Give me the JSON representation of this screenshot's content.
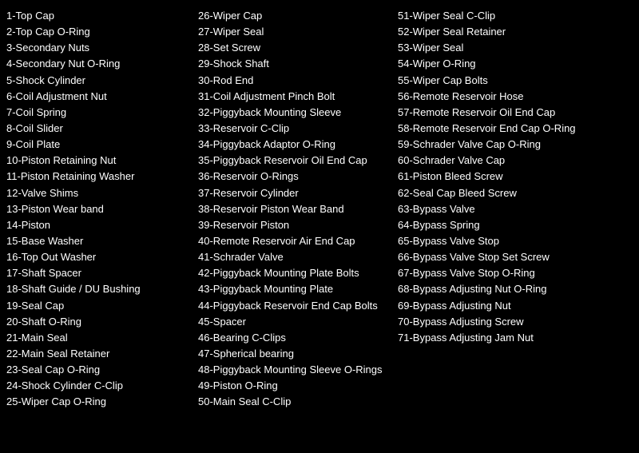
{
  "col1": {
    "items": [
      "1-Top Cap",
      "2-Top Cap O-Ring",
      "3-Secondary Nuts",
      "4-Secondary Nut O-Ring",
      "5-Shock Cylinder",
      "6-Coil Adjustment Nut",
      "7-Coil Spring",
      "8-Coil Slider",
      "9-Coil Plate",
      "10-Piston Retaining Nut",
      "11-Piston Retaining Washer",
      "12-Valve Shims",
      "13-Piston Wear band",
      "14-Piston",
      "15-Base Washer",
      "16-Top Out Washer",
      "17-Shaft Spacer",
      "18-Shaft Guide / DU Bushing",
      "19-Seal Cap",
      "20-Shaft O-Ring",
      "21-Main Seal",
      "22-Main Seal Retainer",
      "23-Seal Cap O-Ring",
      "24-Shock Cylinder C-Clip",
      "25-Wiper Cap O-Ring"
    ]
  },
  "col2": {
    "items": [
      "26-Wiper Cap",
      "27-Wiper Seal",
      "28-Set Screw",
      "29-Shock Shaft",
      "30-Rod End",
      "31-Coil Adjustment Pinch Bolt",
      "32-Piggyback Mounting Sleeve",
      "33-Reservoir C-Clip",
      "34-Piggyback Adaptor O-Ring",
      "35-Piggyback Reservoir Oil End Cap",
      "36-Reservoir O-Rings",
      "37-Reservoir Cylinder",
      "38-Reservoir Piston Wear Band",
      "39-Reservoir Piston",
      "40-Remote Reservoir Air End Cap",
      "41-Schrader Valve",
      "42-Piggyback Mounting Plate Bolts",
      "43-Piggyback Mounting Plate",
      "44-Piggyback Reservoir End Cap Bolts",
      "45-Spacer",
      "46-Bearing C-Clips",
      "47-Spherical bearing",
      "48-Piggyback Mounting Sleeve O-Rings",
      "49-Piston O-Ring",
      "50-Main Seal C-Clip"
    ]
  },
  "col3": {
    "items": [
      "51-Wiper Seal C-Clip",
      "52-Wiper Seal Retainer",
      "53-Wiper Seal",
      "54-Wiper O-Ring",
      "55-Wiper Cap Bolts",
      "56-Remote Reservoir Hose",
      "57-Remote Reservoir Oil End Cap",
      "58-Remote Reservoir End Cap O-Ring",
      "59-Schrader Valve Cap O-Ring",
      "60-Schrader Valve Cap",
      "61-Piston Bleed Screw",
      "62-Seal Cap Bleed Screw",
      "63-Bypass Valve",
      "64-Bypass Spring",
      "65-Bypass Valve Stop",
      "66-Bypass Valve Stop Set Screw",
      "67-Bypass Valve Stop O-Ring",
      "68-Bypass Adjusting Nut O-Ring",
      "69-Bypass Adjusting Nut",
      "70-Bypass Adjusting Screw",
      "71-Bypass Adjusting Jam Nut"
    ]
  }
}
